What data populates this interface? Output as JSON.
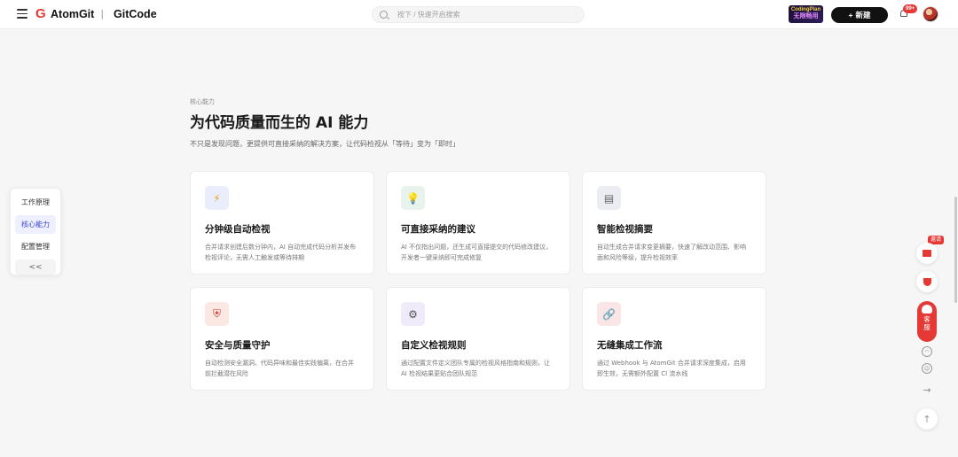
{
  "brand": {
    "name": "AtomGit",
    "separator": "|",
    "product": "GitCode"
  },
  "search": {
    "placeholder": "按下 / 快速开启搜索"
  },
  "promo": {
    "line1": "CodingPlan",
    "line2": "无限畅用"
  },
  "header": {
    "new_label": "新建",
    "notification_count": "99+"
  },
  "leftnav": {
    "items": [
      {
        "label": "工作原理"
      },
      {
        "label": "核心能力"
      },
      {
        "label": "配置管理"
      }
    ],
    "collapse": "<<"
  },
  "main": {
    "eyebrow": "核心能力",
    "title": "为代码质量而生的 AI 能力",
    "subtitle": "不只是发现问题，更提供可直接采纳的解决方案，让代码检视从「等待」变为「即时」",
    "cards": [
      {
        "icon": "⚡",
        "icon_name": "lightning-icon",
        "title": "分钟级自动检视",
        "desc": "合并请求创建后数分钟内，AI 自动完成代码分析并发布检视评论，无需人工触发或等待排期"
      },
      {
        "icon": "💡",
        "icon_name": "lightbulb-icon",
        "title": "可直接采纳的建议",
        "desc": "AI 不仅指出问题，还生成可直接提交的代码修改建议，开发者一键采纳即可完成修复"
      },
      {
        "icon": "▤",
        "icon_name": "summary-doc-icon",
        "title": "智能检视摘要",
        "desc": "自动生成合并请求变更摘要，快速了解改动范围、影响面和风险等级，提升检视效率"
      },
      {
        "icon": "⛨",
        "icon_name": "shield-icon",
        "title": "安全与质量守护",
        "desc": "自动检测安全漏洞、代码异味和最佳实践偏离，在合并前拦截潜在风险"
      },
      {
        "icon": "⚙",
        "icon_name": "gear-icon",
        "title": "自定义检视规则",
        "desc": "通过配置文件定义团队专属的检视风格指南和规则，让 AI 检视结果更贴合团队规范"
      },
      {
        "icon": "🔗",
        "icon_name": "link-icon",
        "title": "无缝集成工作流",
        "desc": "通过 Webhook 与 AtomGit 合并请求深度集成，启用即生效，无需额外配置 CI 流水线"
      }
    ]
  },
  "rail": {
    "invite_label": "邀请",
    "service_line1": "客",
    "service_line2": "服"
  }
}
